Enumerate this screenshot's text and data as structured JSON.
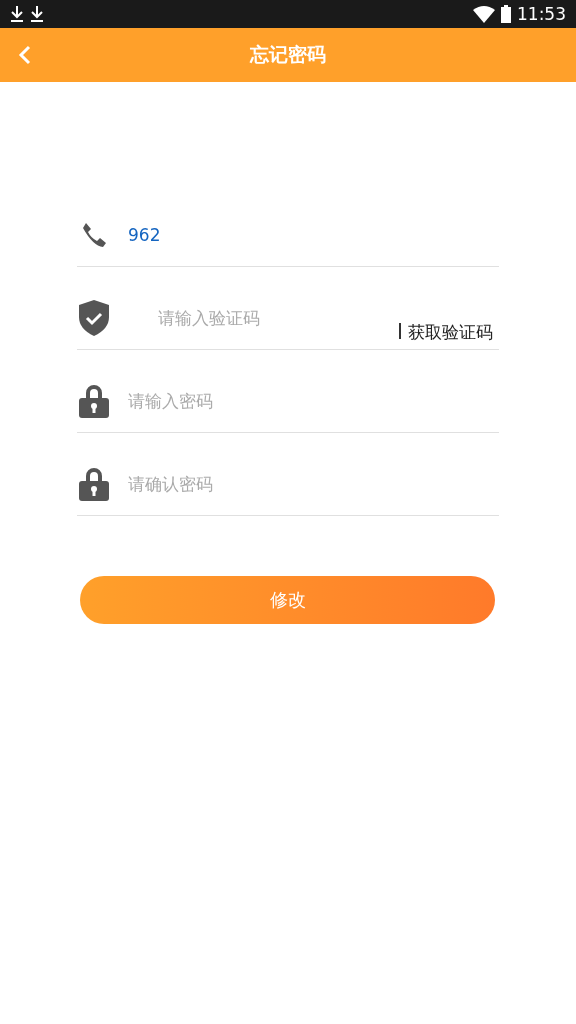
{
  "status_bar": {
    "time": "11:53"
  },
  "header": {
    "title": "忘记密码"
  },
  "fields": [
    {
      "kind": "phone",
      "value": "962"
    },
    {
      "kind": "code",
      "placeholder": "请输入验证码",
      "action": "获取验证码"
    },
    {
      "kind": "password",
      "placeholder": "请输入密码"
    },
    {
      "kind": "password",
      "placeholder": "请确认密码"
    }
  ],
  "submit": "修改"
}
